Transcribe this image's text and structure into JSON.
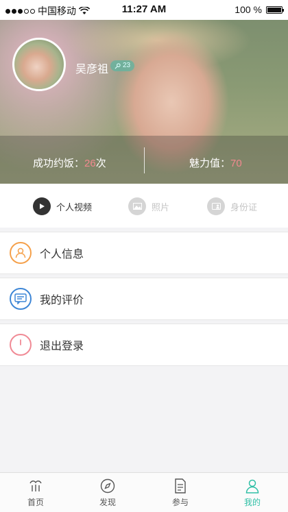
{
  "status_bar": {
    "carrier": "中国移动",
    "time": "11:27 AM",
    "battery": "100 %"
  },
  "profile": {
    "name": "吴彦祖",
    "level": "23",
    "stats": {
      "dates_label": "成功约饭：",
      "dates_value": "26",
      "dates_unit": "次",
      "charm_label": "魅力值：",
      "charm_value": "70"
    }
  },
  "media_tabs": [
    {
      "label": "个人视频",
      "icon": "play-icon",
      "active": true
    },
    {
      "label": "照片",
      "icon": "photo-icon",
      "active": false
    },
    {
      "label": "身份证",
      "icon": "id-card-icon",
      "active": false
    }
  ],
  "menu": [
    {
      "label": "个人信息",
      "icon": "person-icon",
      "color": "#f5a04a"
    },
    {
      "label": "我的评价",
      "icon": "message-icon",
      "color": "#3d86d6"
    },
    {
      "label": "退出登录",
      "icon": "power-icon",
      "color": "#f08a95"
    }
  ],
  "bottom_nav": [
    {
      "label": "首页",
      "icon": "home-icon"
    },
    {
      "label": "发现",
      "icon": "compass-icon"
    },
    {
      "label": "参与",
      "icon": "document-icon"
    },
    {
      "label": "我的",
      "icon": "user-icon",
      "active": true
    }
  ],
  "colors": {
    "accent": "#2fbfa6",
    "stat_value": "#f2898f"
  }
}
